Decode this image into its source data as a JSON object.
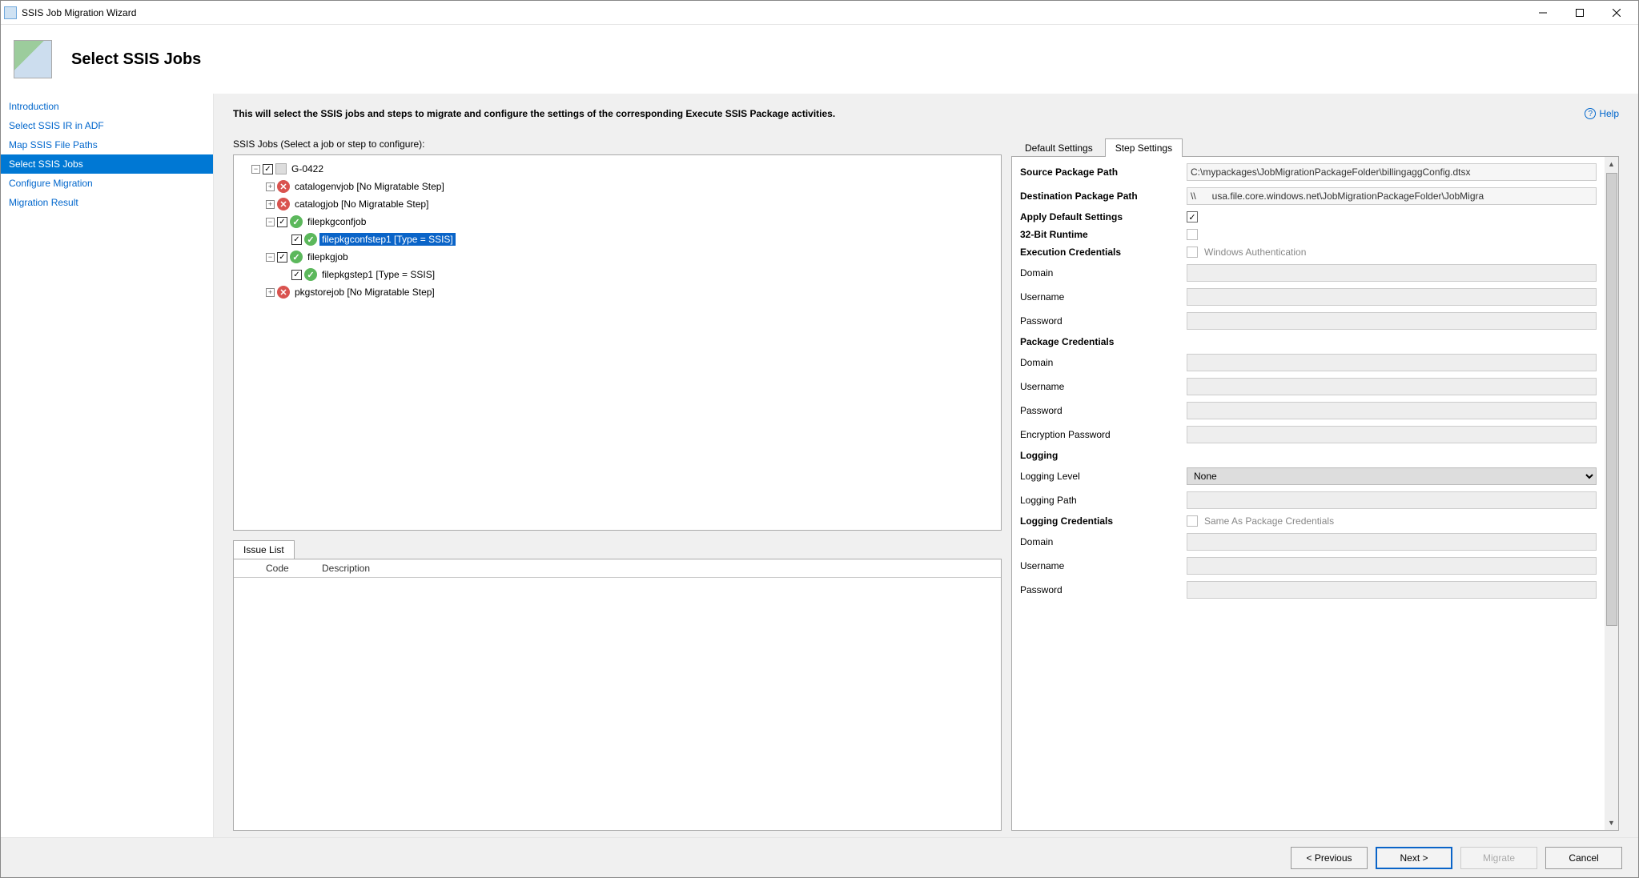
{
  "window": {
    "title": "SSIS Job Migration Wizard"
  },
  "header": {
    "title": "Select SSIS Jobs"
  },
  "help": {
    "label": "Help"
  },
  "sidebar": {
    "items": [
      {
        "label": "Introduction",
        "selected": false
      },
      {
        "label": "Select SSIS IR in ADF",
        "selected": false
      },
      {
        "label": "Map SSIS File Paths",
        "selected": false
      },
      {
        "label": "Select SSIS Jobs",
        "selected": true
      },
      {
        "label": "Configure Migration",
        "selected": false
      },
      {
        "label": "Migration Result",
        "selected": false
      }
    ]
  },
  "content": {
    "intro": "This will select the SSIS jobs and steps to migrate and configure the settings of the corresponding Execute SSIS Package activities.",
    "tree_label": "SSIS Jobs (Select a job or step to configure):"
  },
  "tree": {
    "root": {
      "label": "G-0422"
    },
    "n_catalogenvjob": {
      "label": "catalogenvjob [No Migratable Step]"
    },
    "n_catalogjob": {
      "label": "catalogjob [No Migratable Step]"
    },
    "n_filepkgconfjob": {
      "label": "filepkgconfjob"
    },
    "n_filepkgconfstep1": {
      "label": "filepkgconfstep1 [Type = SSIS]"
    },
    "n_filepkgjob": {
      "label": "filepkgjob"
    },
    "n_filepkgstep1": {
      "label": "filepkgstep1 [Type = SSIS]"
    },
    "n_pkgstorejob": {
      "label": "pkgstorejob [No Migratable Step]"
    }
  },
  "issue": {
    "tab": "Issue List",
    "col_code": "Code",
    "col_desc": "Description"
  },
  "tabs": {
    "default": "Default Settings",
    "step": "Step Settings"
  },
  "settings": {
    "source_path_label": "Source Package Path",
    "source_path_value": "C:\\mypackages\\JobMigrationPackageFolder\\billingaggConfig.dtsx",
    "dest_path_label": "Destination Package Path",
    "dest_path_value": "\\\\      usa.file.core.windows.net\\JobMigrationPackageFolder\\JobMigra",
    "apply_defaults_label": "Apply Default Settings",
    "runtime32_label": "32-Bit Runtime",
    "exec_creds_label": "Execution Credentials",
    "exec_creds_hint": "Windows Authentication",
    "domain_label": "Domain",
    "username_label": "Username",
    "password_label": "Password",
    "package_creds_label": "Package Credentials",
    "encryption_pw_label": "Encryption Password",
    "logging_label": "Logging",
    "logging_level_label": "Logging Level",
    "logging_level_value": "None",
    "logging_path_label": "Logging Path",
    "logging_creds_label": "Logging Credentials",
    "logging_creds_hint": "Same As Package Credentials"
  },
  "footer": {
    "previous": "< Previous",
    "next": "Next >",
    "migrate": "Migrate",
    "cancel": "Cancel"
  }
}
